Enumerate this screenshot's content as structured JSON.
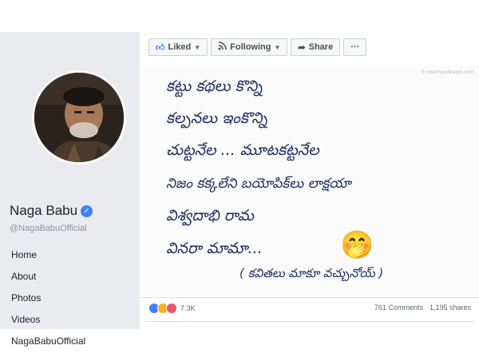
{
  "profile": {
    "name": "Naga Babu",
    "handle": "@NagaBabuOfficial",
    "verified": true
  },
  "nav": {
    "items": [
      "Home",
      "About",
      "Photos",
      "Videos",
      "NagaBabuOfficial"
    ]
  },
  "actions": {
    "liked": "Liked",
    "following": "Following",
    "share": "Share",
    "more": "···"
  },
  "post_image": {
    "watermark": "© onemaydesign.com",
    "lines": [
      "కట్టు కథలు కొన్ని",
      "కల్పనలు ఇంకొన్ని",
      "చుట్టనేల ... మూటకట్టనేల",
      "నిజం కక్కలేని బయోపిక్‌లు లాక్షయా",
      "విశ్వదాభి రామ",
      "వినరా మామా...",
      "( కవితలు మాకూ వచ్చునోయ్ )"
    ],
    "emoji": "🤭"
  },
  "post_footer": {
    "reaction_count": "7.3K",
    "comments": "761 Comments",
    "shares": "1,195 shares"
  },
  "colors": {
    "sidebar_bg": "#e9ebee",
    "verified": "#4080ff",
    "ink": "#1f2f66"
  }
}
